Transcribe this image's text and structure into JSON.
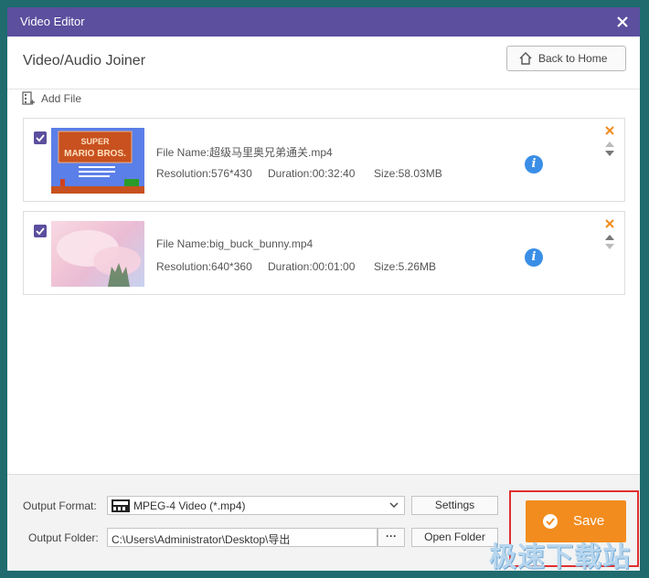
{
  "window": {
    "title": "Video Editor"
  },
  "header": {
    "title": "Video/Audio Joiner",
    "back_label": "Back to Home"
  },
  "toolbar": {
    "add_file_label": "Add File"
  },
  "files": [
    {
      "checked": true,
      "name": "File Name:超级马里奥兄弟通关.mp4",
      "resolution": "Resolution:576*430",
      "duration": "Duration:00:32:40",
      "size": "Size:58.03MB",
      "thumb_text": "SUPER MARIO BROS."
    },
    {
      "checked": true,
      "name": "File Name:big_buck_bunny.mp4",
      "resolution": "Resolution:640*360",
      "duration": "Duration:00:01:00",
      "size": "Size:5.26MB"
    }
  ],
  "output": {
    "format_label": "Output Format:",
    "format_value": "MPEG-4 Video (*.mp4)",
    "settings_label": "Settings",
    "folder_label": "Output Folder:",
    "folder_value": "C:\\Users\\Administrator\\Desktop\\导出",
    "browse_label": "···",
    "open_folder_label": "Open Folder",
    "save_label": "Save"
  },
  "watermark": "极速下载站",
  "colors": {
    "titlebar": "#5b4f9e",
    "accent": "#f28c1e",
    "info": "#3a8ee6",
    "highlight": "#e03030"
  }
}
